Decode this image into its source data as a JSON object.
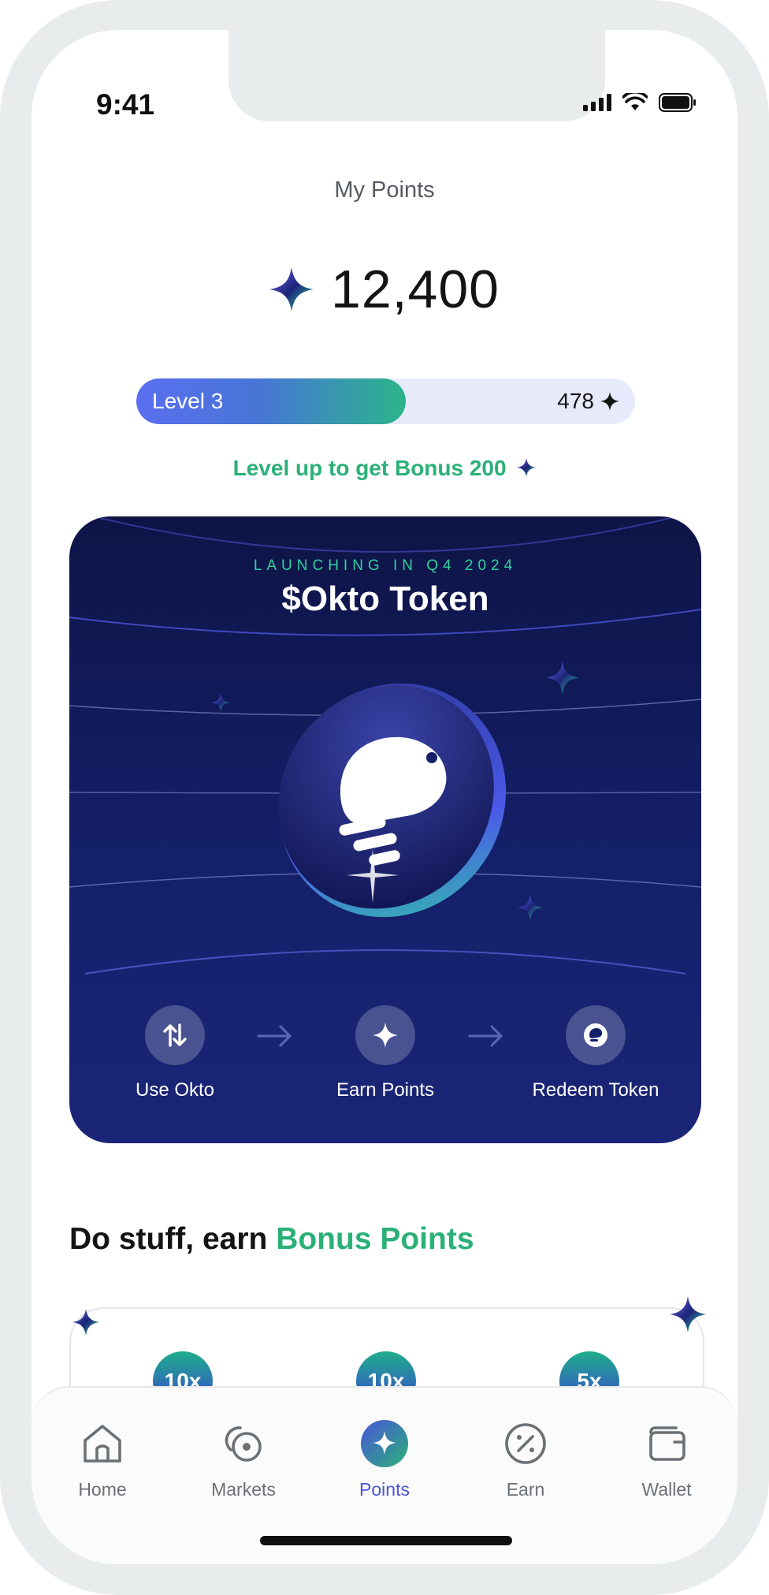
{
  "status_bar": {
    "time": "9:41"
  },
  "points": {
    "title": "My Points",
    "value": "12,400",
    "level_label": "Level 3",
    "level_progress": 0.54,
    "remaining": "478",
    "levelup_text": "Level up to get Bonus 200"
  },
  "token_card": {
    "launch_text": "LAUNCHING IN Q4 2024",
    "title": "$Okto Token",
    "steps": [
      {
        "label": "Use Okto",
        "icon": "swap-arrows-icon"
      },
      {
        "label": "Earn Points",
        "icon": "sparkle-icon"
      },
      {
        "label": "Redeem Token",
        "icon": "okto-logo-icon"
      }
    ]
  },
  "bonus": {
    "heading_prefix": "Do stuff, earn ",
    "heading_accent": "Bonus Points",
    "multipliers": [
      "10x",
      "10x",
      "5x"
    ]
  },
  "tabs": [
    {
      "label": "Home",
      "icon": "home-icon",
      "active": false
    },
    {
      "label": "Markets",
      "icon": "markets-icon",
      "active": false
    },
    {
      "label": "Points",
      "icon": "sparkle-icon",
      "active": true
    },
    {
      "label": "Earn",
      "icon": "percent-icon",
      "active": false
    },
    {
      "label": "Wallet",
      "icon": "wallet-icon",
      "active": false
    }
  ],
  "colors": {
    "accent_green": "#2bb078",
    "accent_blue": "#4a55d9",
    "card_navy": "#14206a"
  }
}
